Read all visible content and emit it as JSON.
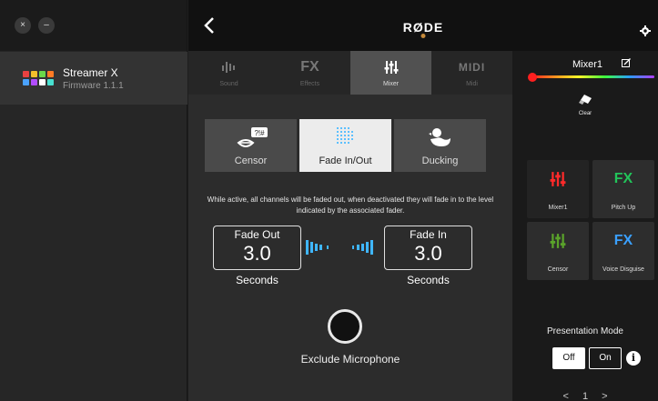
{
  "window": {
    "close_glyph": "×",
    "minimize_glyph": "–"
  },
  "device": {
    "name": "Streamer X",
    "firmware": "Firmware 1.1.1"
  },
  "header": {
    "logo_text": "RØDE",
    "logo_dot_color": "#c58a3b"
  },
  "tabs": [
    {
      "label": "Sound",
      "icon": "sound-icon"
    },
    {
      "label": "Effects",
      "icon": "fx-icon",
      "icon_text": "FX"
    },
    {
      "label": "Mixer",
      "icon": "mixer-icon",
      "active": true
    },
    {
      "label": "Midi",
      "icon": "midi-icon",
      "icon_text": "MIDI"
    }
  ],
  "effects": [
    {
      "label": "Censor",
      "icon": "censor-lips-icon",
      "active": false
    },
    {
      "label": "Fade In/Out",
      "icon": "fade-grid-icon",
      "active": true
    },
    {
      "label": "Ducking",
      "icon": "duck-icon",
      "active": false
    }
  ],
  "description": "While active, all channels will be faded out, when deactivated they will fade in to the level indicated by the associated fader.",
  "fade_out": {
    "label": "Fade Out",
    "value": "3.0",
    "unit": "Seconds"
  },
  "fade_in": {
    "label": "Fade In",
    "value": "3.0",
    "unit": "Seconds"
  },
  "exclude_microphone": {
    "label": "Exclude Microphone",
    "enabled": false
  },
  "right_panel": {
    "mixer_name": "Mixer1",
    "clear_label": "Clear",
    "pads": [
      {
        "label": "Mixer1",
        "icon": "mixer-icon",
        "icon_color": "#ff2a2a"
      },
      {
        "label": "Pitch Up",
        "icon": "fx-icon",
        "icon_text": "FX",
        "icon_color": "#22c45a"
      },
      {
        "label": "Censor",
        "icon": "mixer-icon",
        "icon_color": "#5aa32a"
      },
      {
        "label": "Voice Disguise",
        "icon": "fx-icon",
        "icon_text": "FX",
        "icon_color": "#3aa0ff"
      }
    ],
    "presentation_mode": {
      "label": "Presentation Mode",
      "off_label": "Off",
      "on_label": "On",
      "selected": "Off",
      "info_glyph": "i"
    },
    "pager": {
      "prev": "<",
      "page": "1",
      "next": ">"
    }
  },
  "colors": {
    "accent_cyan": "#3fb6ff",
    "active_bg": "#ececec",
    "spectrum_start": "#ff1f1f"
  }
}
